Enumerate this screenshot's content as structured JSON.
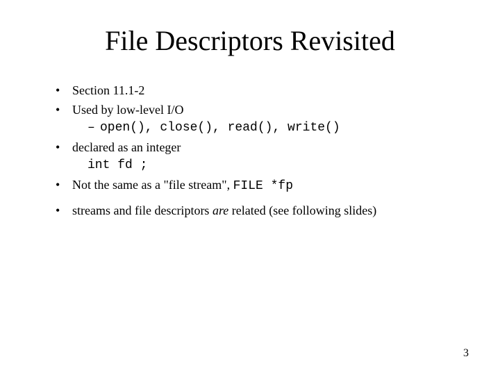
{
  "slide": {
    "title": "File Descriptors Revisited",
    "bullets": {
      "b1": "Section 11.1-2",
      "b2": "Used by low-level I/O",
      "b2_sub": "open(), close(), read(), write()",
      "b3": "declared as an integer",
      "b3_code": "int fd ;",
      "b4_prefix": "Not the same as a \"file stream\", ",
      "b4_code": "FILE *fp",
      "b5_prefix": "streams and file descriptors ",
      "b5_italic": "are",
      "b5_suffix": " related (see following slides)"
    },
    "page_number": "3"
  }
}
